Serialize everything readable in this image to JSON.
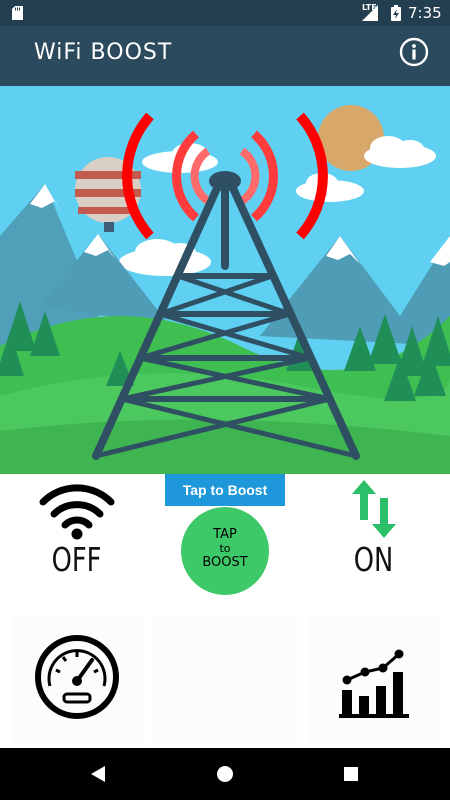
{
  "status_bar": {
    "network": "LTE",
    "time": "7:35"
  },
  "app_bar": {
    "title": "WiFi BOOST",
    "info_icon": "info-icon"
  },
  "colors": {
    "status_bar": "#233e4e",
    "app_bar": "#2c4a5d",
    "sky": "#5fd0f2",
    "signal_waves": "#ff0000",
    "tower": "#2f4f63",
    "boost_button": "#3ec969",
    "boost_label": "#1e97db",
    "arrow_green": "#2bbf6a"
  },
  "controls": {
    "wifi": {
      "icon": "wifi-icon",
      "state": "OFF"
    },
    "boost": {
      "label": "Tap to Boost",
      "button_line1": "TAP",
      "button_line2": "to",
      "button_line3": "BOOST"
    },
    "data": {
      "icon": "data-transfer-icon",
      "state": "ON"
    }
  },
  "bottom": {
    "left_icon": "speedometer-icon",
    "right_icon": "bar-chart-icon"
  },
  "nav": {
    "back_icon": "back-icon",
    "home_icon": "home-icon",
    "recent_icon": "recent-apps-icon"
  }
}
